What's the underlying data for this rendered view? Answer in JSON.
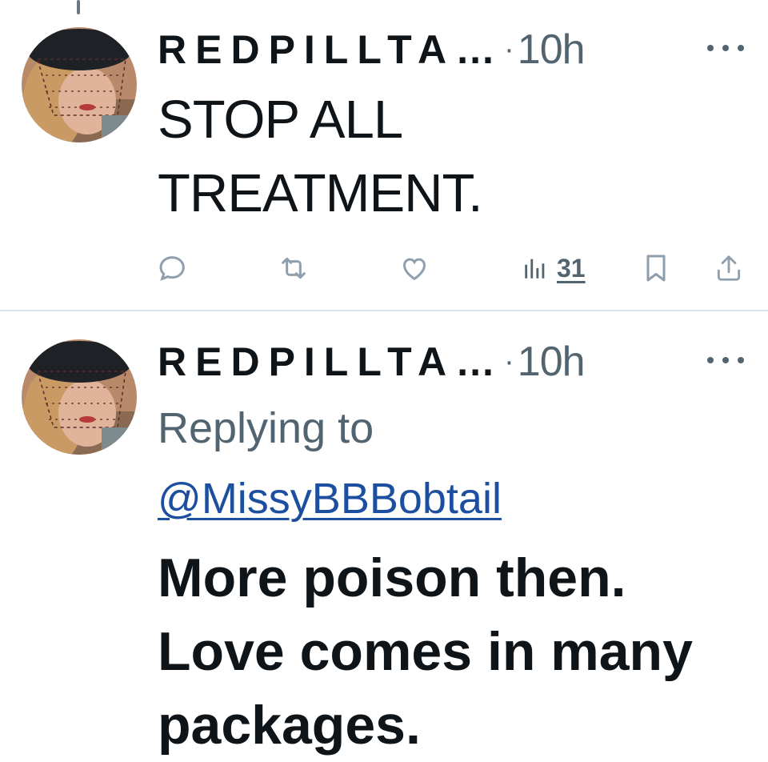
{
  "tweets": [
    {
      "display_name": "REDPILLTA…",
      "separator": "·",
      "time": "10h",
      "text_lines": [
        "STOP ALL",
        "TREATMENT."
      ],
      "views": "31"
    },
    {
      "display_name": "REDPILLTA…",
      "separator": "·",
      "time": "10h",
      "replying_to_label": "Replying to",
      "mention": "@MissyBBBobtail",
      "text_lines": [
        "More poison then.",
        "Love comes in many",
        "packages."
      ]
    }
  ],
  "icons": {
    "reply": "reply-icon",
    "retweet": "retweet-icon",
    "like": "like-icon",
    "views": "views-icon",
    "bookmark": "bookmark-icon",
    "share": "share-icon",
    "more": "more-icon"
  },
  "colors": {
    "text": "#0f1419",
    "secondary": "#536471",
    "link": "#1d4fa0",
    "divider": "#dde3ea"
  }
}
